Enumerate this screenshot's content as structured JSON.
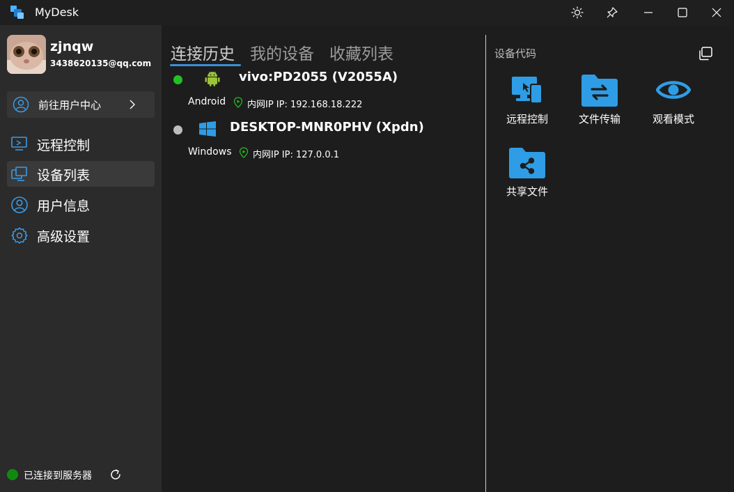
{
  "app": {
    "title": "MyDesk"
  },
  "user": {
    "name": "zjnqw",
    "email": "3438620135@qq.com",
    "user_center_label": "前往用户中心"
  },
  "nav": {
    "items": [
      {
        "label": "远程控制",
        "icon": "remote-desktop-icon"
      },
      {
        "label": "设备列表",
        "icon": "device-list-icon"
      },
      {
        "label": "用户信息",
        "icon": "user-icon"
      },
      {
        "label": "高级设置",
        "icon": "gear-icon"
      }
    ],
    "active": "设备列表"
  },
  "status": {
    "label": "已连接到服务器",
    "color": "#0f8a0f"
  },
  "tabs": [
    {
      "label": "连接历史"
    },
    {
      "label": "我的设备"
    },
    {
      "label": "收藏列表"
    }
  ],
  "devices": [
    {
      "name": "vivo:PD2055 (V2055A)",
      "os": "Android",
      "ip": "内网IP IP: 192.168.18.222",
      "online": true,
      "status_color": "#22c022"
    },
    {
      "name": "DESKTOP-MNR0PHV (Xpdn)",
      "os": "Windows",
      "ip": "内网IP IP: 127.0.0.1",
      "online": false,
      "status_color": "#bdbdbd"
    }
  ],
  "right_panel": {
    "code_label": "设备代码",
    "actions": [
      {
        "label": "远程控制",
        "icon": "remote-control-icon"
      },
      {
        "label": "文件传输",
        "icon": "file-transfer-icon"
      },
      {
        "label": "观看模式",
        "icon": "view-mode-icon"
      },
      {
        "label": "共享文件",
        "icon": "share-file-icon"
      }
    ]
  },
  "colors": {
    "accent": "#3b8fd9",
    "icon_blue": "#2e9de6"
  }
}
